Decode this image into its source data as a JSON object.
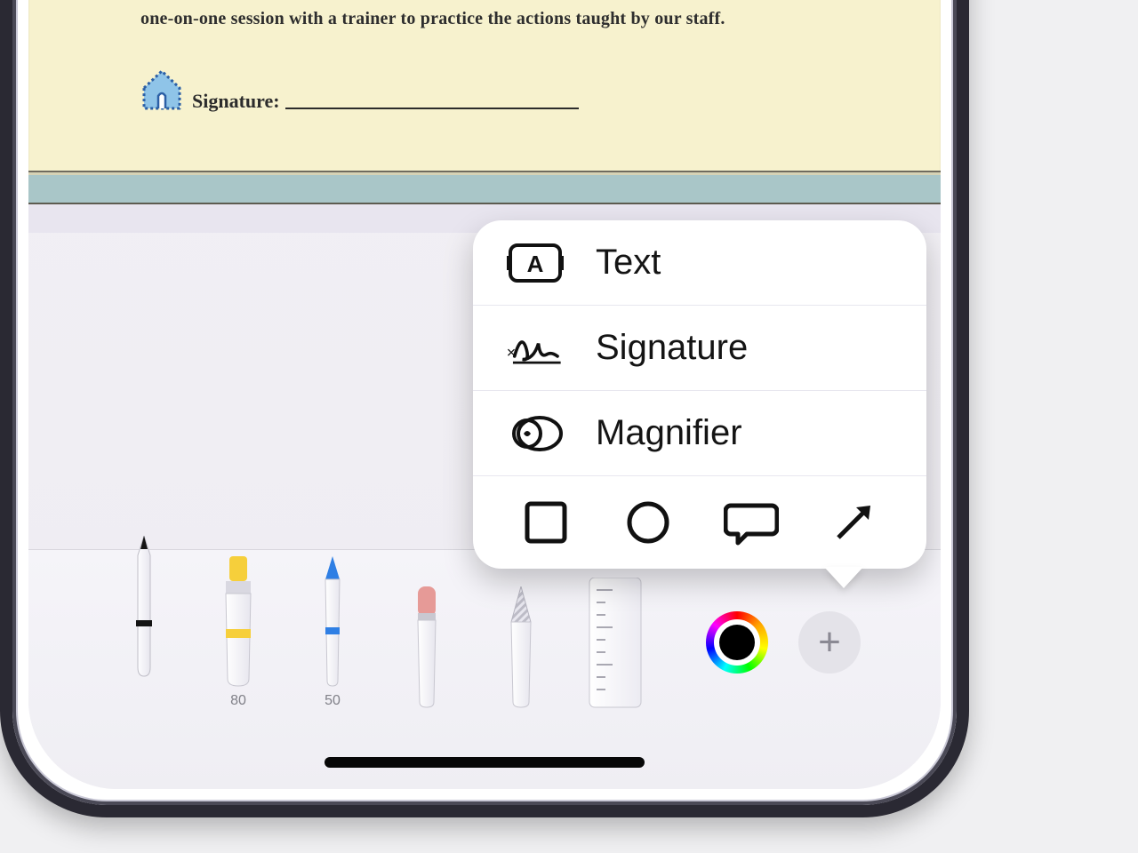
{
  "document": {
    "body_text": "one-on-one session with a trainer to practice the actions taught by our staff.",
    "signature_label": "Signature:"
  },
  "toolbar": {
    "tools": {
      "pen": {
        "selected": true
      },
      "highlighter": {
        "size": "80"
      },
      "pencil": {
        "size": "50"
      },
      "eraser": {},
      "lasso": {},
      "ruler": {}
    },
    "color": "#000000"
  },
  "popover": {
    "items": [
      {
        "key": "text",
        "label": "Text"
      },
      {
        "key": "signature",
        "label": "Signature"
      },
      {
        "key": "magnifier",
        "label": "Magnifier"
      }
    ],
    "shapes": [
      "square",
      "circle",
      "speech",
      "arrow"
    ]
  }
}
